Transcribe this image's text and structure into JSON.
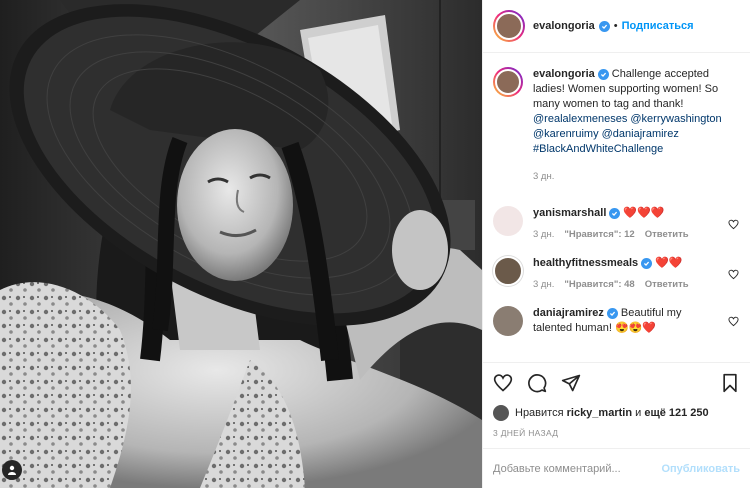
{
  "post": {
    "author": "evalongoria",
    "follow_label": "Подписаться",
    "dot": "•",
    "caption_text": "Challenge accepted ladies! Women supporting women! So many women to tag and thank!",
    "mentions": [
      "@realalexmeneses",
      "@kerrywashington",
      "@karenruimy",
      "@daniajramirez"
    ],
    "hashtag": "#BlackAndWhiteChallenge",
    "caption_time": "3 дн."
  },
  "comments": [
    {
      "user": "yanismarshall",
      "text": "❤️❤️❤️",
      "time": "3 дн.",
      "likes": "\"Нравится\": 12",
      "reply": "Ответить"
    },
    {
      "user": "healthyfitnessmeals",
      "text": "❤️❤️",
      "time": "3 дн.",
      "likes": "\"Нравится\": 48",
      "reply": "Ответить"
    },
    {
      "user": "daniajramirez",
      "text": "Beautiful my talented human! 😍😍❤️",
      "time": "",
      "likes": "",
      "reply": ""
    }
  ],
  "likes": {
    "prefix": "Нравится",
    "user": "ricky_martin",
    "conj": "и",
    "more": "ещё 121 250"
  },
  "posted_ago": "3 ДНЕЙ НАЗАД",
  "add_comment": {
    "placeholder": "Добавьте комментарий...",
    "publish_label": "Опубликовать"
  },
  "colors": {
    "accent": "#0095f6",
    "verified": "#3897f0",
    "link": "#00376b",
    "muted": "#8e8e8e",
    "publish_disabled": "#b2dffc"
  }
}
